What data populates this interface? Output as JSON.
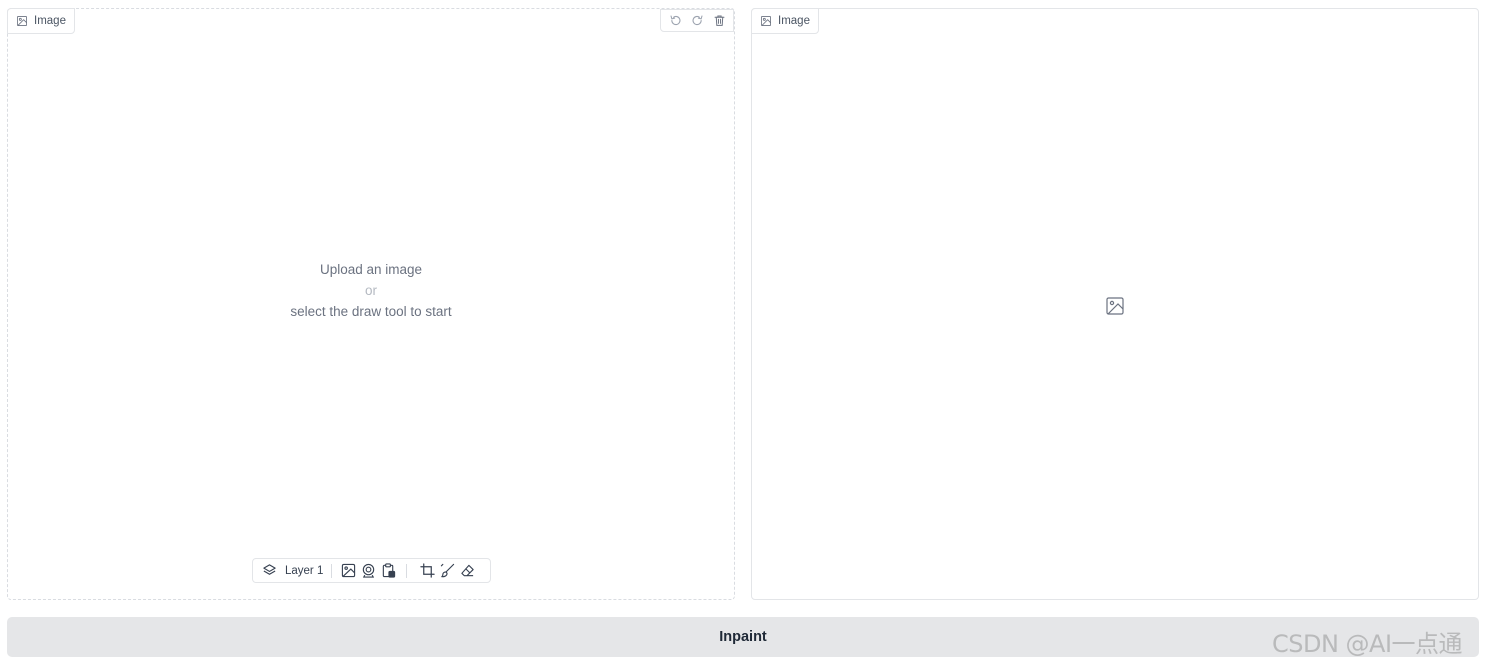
{
  "editor": {
    "label": "Image",
    "label_icon": "image-icon",
    "history": {
      "undo_icon": "undo-icon",
      "redo_icon": "redo-icon",
      "clear_icon": "trash-icon"
    },
    "prompt": {
      "line1": "Upload an image",
      "line2": "or",
      "line3": "select the draw tool to start"
    },
    "toolbar": {
      "layer_icon": "layers-icon",
      "layer_label": "Layer 1",
      "source_tools": [
        "upload-image-icon",
        "webcam-icon",
        "clipboard-icon"
      ],
      "edit_tools": [
        "crop-icon",
        "brush-icon",
        "eraser-icon"
      ]
    }
  },
  "output": {
    "label": "Image",
    "label_icon": "image-icon",
    "empty_icon": "image-placeholder-icon"
  },
  "actions": {
    "inpaint_label": "Inpaint"
  },
  "watermark": {
    "text": "CSDN @AI一点通"
  },
  "colors": {
    "button_bg": "#e5e6e8",
    "border": "#e3e5e8",
    "text_muted": "#6b7280"
  }
}
